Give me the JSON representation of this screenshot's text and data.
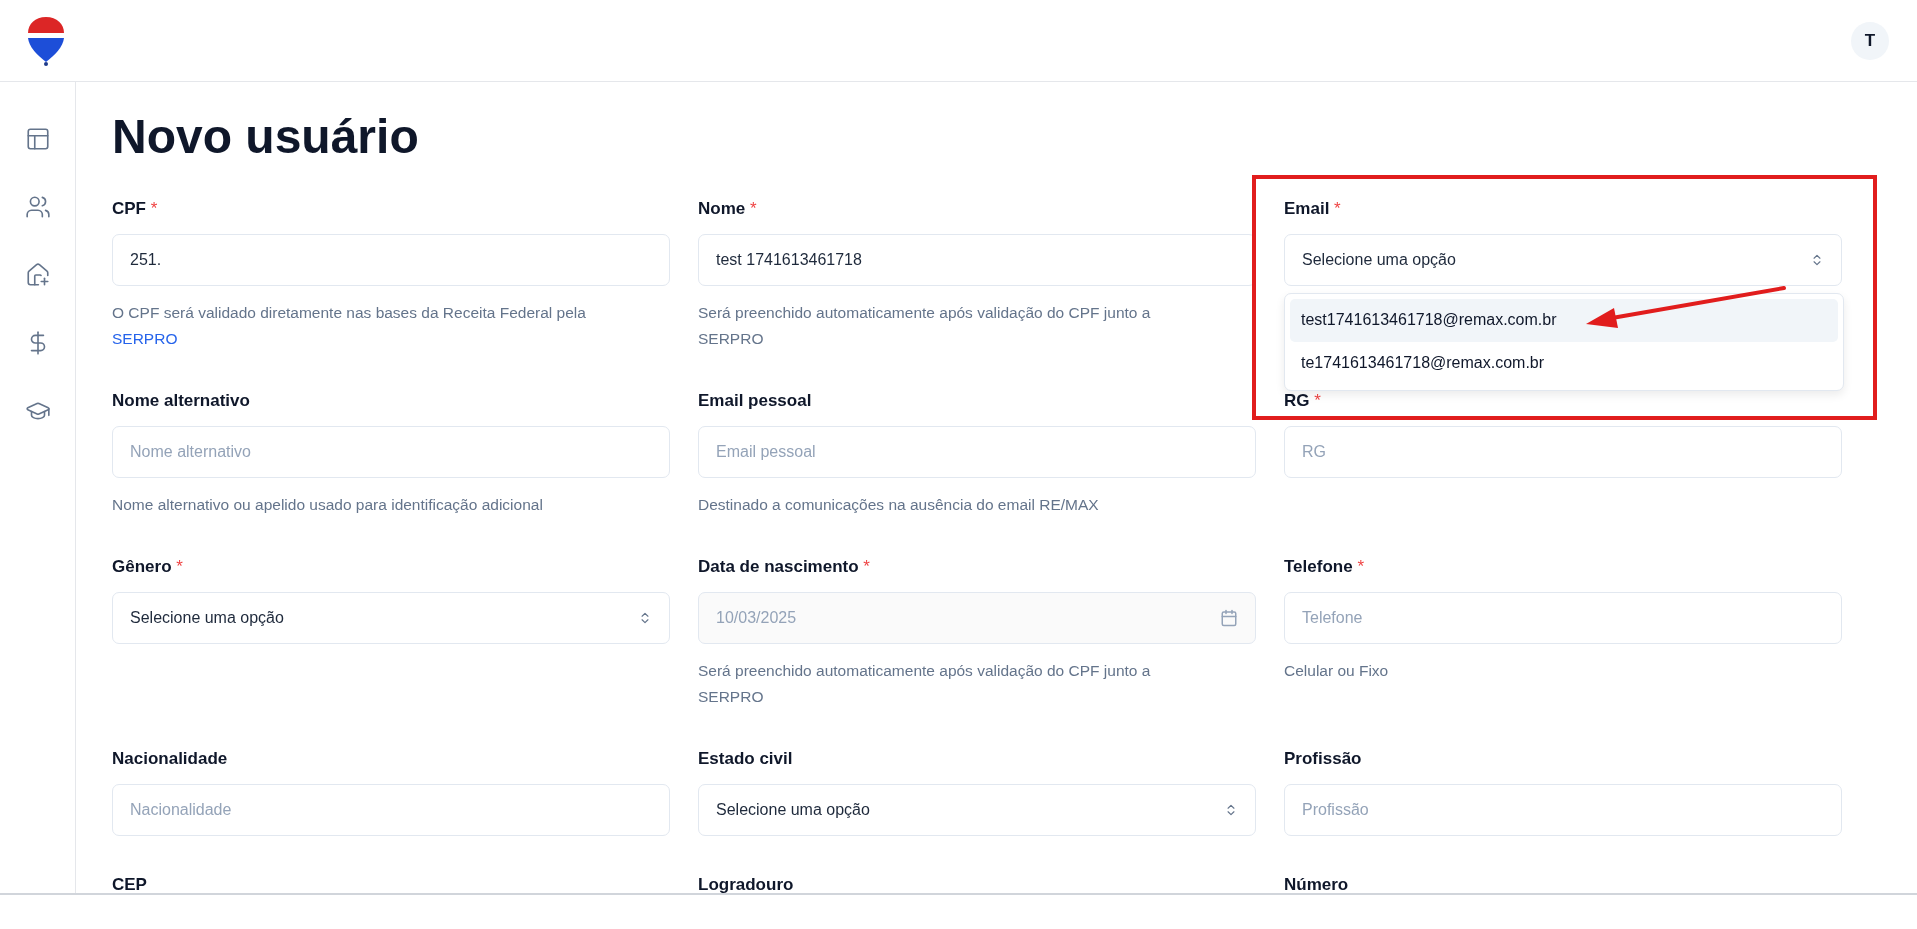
{
  "header": {
    "avatar": "T"
  },
  "page": {
    "title": "Novo usuário"
  },
  "form": {
    "rows": [
      [
        {
          "kind": "text",
          "label": "CPF",
          "required_mark": "*",
          "value": "251.",
          "help": "O CPF será validado diretamente nas bases da Receita Federal pela",
          "help_link": "SERPRO"
        },
        {
          "kind": "text",
          "label": "Nome",
          "required_mark": "*",
          "value": "test 1741613461718",
          "help": "Será preenchido automaticamente após validação do CPF junto a SERPRO"
        },
        {
          "kind": "select",
          "label": "Email",
          "required_mark": "*",
          "placeholder": "Selecione uma opção",
          "options": [
            {
              "label": "test1741613461718@remax.com.br",
              "selected": true
            },
            {
              "label": "te1741613461718@remax.com.br",
              "selected": false
            }
          ]
        }
      ],
      [
        {
          "kind": "text",
          "label": "Nome alternativo",
          "placeholder": "Nome alternativo",
          "help": "Nome alternativo ou apelido usado para identificação adicional"
        },
        {
          "kind": "text",
          "label": "Email pessoal",
          "placeholder": "Email pessoal",
          "help": "Destinado a comunicações na ausência do email RE/MAX"
        },
        {
          "kind": "text",
          "label": "RG",
          "required_mark": "*",
          "placeholder": "RG"
        }
      ],
      [
        {
          "kind": "select",
          "label": "Gênero",
          "required_mark": "*",
          "placeholder": "Selecione uma opção"
        },
        {
          "kind": "date",
          "label": "Data de nascimento",
          "required_mark": "*",
          "value": "10/03/2025",
          "disabled": true,
          "help": "Será preenchido automaticamente após validação do CPF junto a SERPRO"
        },
        {
          "kind": "text",
          "label": "Telefone",
          "required_mark": "*",
          "placeholder": "Telefone",
          "help": "Celular ou Fixo"
        }
      ],
      [
        {
          "kind": "text",
          "label": "Nacionalidade",
          "placeholder": "Nacionalidade"
        },
        {
          "kind": "select",
          "label": "Estado civil",
          "placeholder": "Selecione uma opção"
        },
        {
          "kind": "text",
          "label": "Profissão",
          "placeholder": "Profissão"
        }
      ],
      [
        {
          "kind": "cut",
          "label": "CEP"
        },
        {
          "kind": "cut",
          "label": "Logradouro"
        },
        {
          "kind": "cut",
          "label": "Número"
        }
      ]
    ]
  },
  "annotation": {
    "box": true,
    "arrow": true
  }
}
